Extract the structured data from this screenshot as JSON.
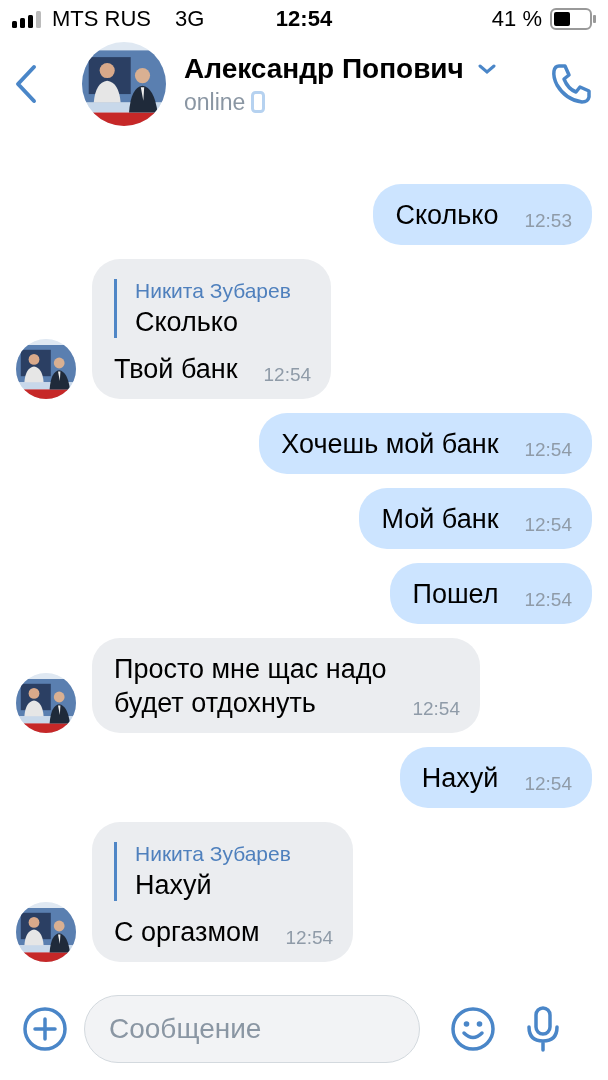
{
  "status_bar": {
    "carrier": "MTS RUS",
    "network": "3G",
    "time": "12:54",
    "battery": "41 %"
  },
  "header": {
    "name": "Александр Попович",
    "status": "online"
  },
  "messages": [
    {
      "kind": "out",
      "text": "Сколько",
      "time": "12:53"
    },
    {
      "kind": "in",
      "reply": {
        "author": "Никита Зубарев",
        "text": "Сколько"
      },
      "text": "Твой банк",
      "time": "12:54"
    },
    {
      "kind": "out",
      "text": "Хочешь мой банк",
      "time": "12:54"
    },
    {
      "kind": "out",
      "text": "Мой банк",
      "time": "12:54"
    },
    {
      "kind": "out",
      "text": "Пошел",
      "time": "12:54"
    },
    {
      "kind": "in",
      "text": "Просто мне щас надо\nбудет отдохнуть",
      "time": "12:54"
    },
    {
      "kind": "out",
      "text": "Нахуй",
      "time": "12:54"
    },
    {
      "kind": "in",
      "reply": {
        "author": "Никита Зубарев",
        "text": "Нахуй"
      },
      "text": "С оргазмом",
      "time": "12:54"
    }
  ],
  "composer": {
    "placeholder": "Сообщение"
  }
}
